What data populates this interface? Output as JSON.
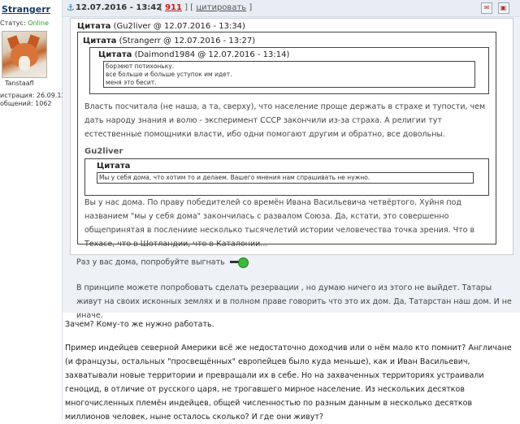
{
  "user": {
    "name": "Strangerr",
    "status_label": "Статус:",
    "status_value": "Online",
    "nickname": "Tanstaafl",
    "reg_line": "истрация: 26.09.13",
    "posts_line": "общений: 1062"
  },
  "post_header": {
    "anchor": "⚓",
    "date": "12.07.2016 - 13:42",
    "bracket_open": "[",
    "number": "911",
    "separator": "] [",
    "quote_link": "цитировать",
    "bracket_close": "]",
    "icon1": "✉",
    "icon2": "▣"
  },
  "quote1": {
    "label": "Цитата",
    "source": "(Gu2liver @ 12.07.2016 - 13:34)"
  },
  "quote2": {
    "label": "Цитата",
    "source": "(Strangerr @ 12.07.2016 - 13:27)"
  },
  "quote3": {
    "label": "Цитата",
    "source": "(Daimond1984 @ 12.07.2016 - 13:14)",
    "line1": "борзеют потихоньку.",
    "line2": "все больше и больше уступок им идет.",
    "line3": "меня это бесит."
  },
  "strangerr_text": "Власть посчитала (не наша, а та, сверху), что население проще держать в страхе и тупости, чем дать народу знания и волю - эксперимент СССР закончили из-за страха. А религии тут естественные помощники власти, ибо одни помогают другим и обратно, все довольны.",
  "gu2liver_label": "Gu2liver",
  "quote4": {
    "label": "Цитата",
    "text": "Мы у себя дома, что хотим то и делаем. Вашего мнения нам спрашивать не нужно."
  },
  "gu2liver_reply": "Вы у нас дома. По праву победителей со времён Ивана Васильевича четвёртого. Хуйня под названием \"мы у себя дома\" закончилась с развалом Союза. Да, кстати, это совершенно общепринятая в послениие несколько тысячелетий истории человечества точка зрения. Что в Техасе, что в Шотландии, что в Каталонии...",
  "raz_text": "Раз у вас дома, попробуйте выгнать",
  "reservation_text": "В принципе можете попробовать сделать резервации , но думаю ничего из этого не выйдет. Татары живут на своих исконных землях и в полном праве говорить что это их дом. Да, Татарстан наш дом. И не иначе.",
  "reply_short": "Зачем? Кому-то же нужно работать.",
  "reply_long": "Пример индейцев северной Америки всё же недостаточно доходчив или о нём мало кто помнит? Англичане (и французы, остальных \"просвещённых\" европейцев было куда меньше), как и Иван Васильевич, захватывали новые территории и превращали их в себе. Но на захваченных территориях устраивали геноцид, в отличие от русского царя, не трогавшего мирное население. Из нескольких десятков многочисленных племён индейцев, общей численностью по разным данным в несколько десятков миллионов человек, ныне осталось сколько? И где они живут?"
}
